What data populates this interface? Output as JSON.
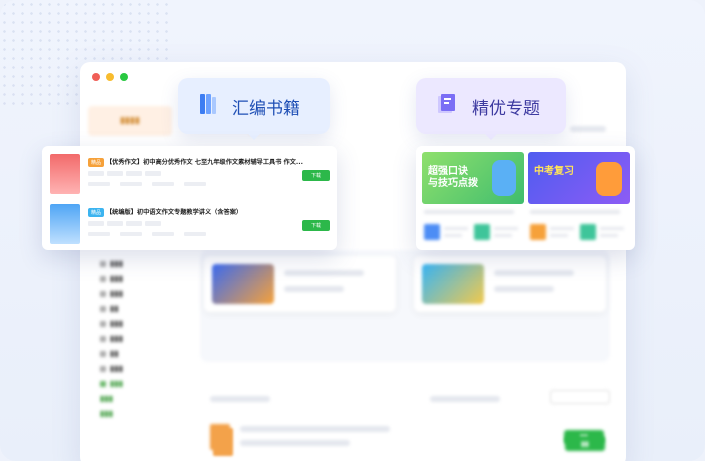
{
  "tabs": {
    "collection": {
      "label": "汇编书籍",
      "icon": "book-stack-icon",
      "color": "#1f4fb5"
    },
    "topics": {
      "label": "精优专题",
      "icon": "book-topic-icon",
      "color": "#3d3aa0"
    }
  },
  "doc_list": [
    {
      "tag": "精品",
      "title": "【优秀作文】初中高分优秀作文 七至九年级作文素材辅导工具书 作文...",
      "download": "下载"
    },
    {
      "tag": "精品",
      "title": "【统编版】初中语文作文专题教学讲义（含答案）",
      "download": "下载"
    }
  ],
  "topics": [
    {
      "banner_title": "超强口诀\n与技巧点拨"
    },
    {
      "banner_title": "中考复习"
    }
  ],
  "colors": {
    "download_green": "#2cb84a",
    "accent_orange": "#f6a13a"
  }
}
